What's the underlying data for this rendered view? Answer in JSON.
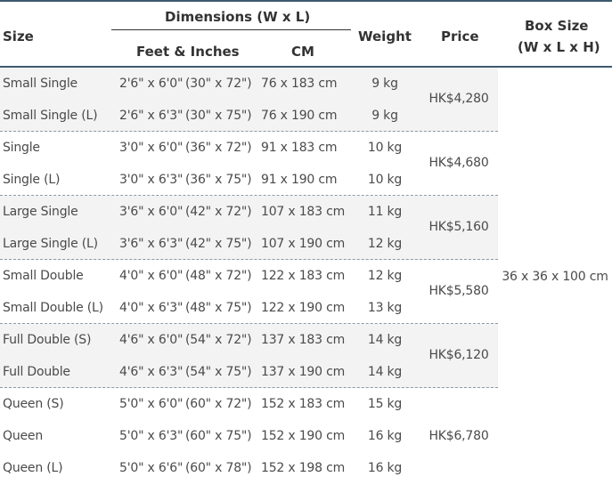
{
  "headers": {
    "size": "Size",
    "dimensions": "Dimensions (W x L)",
    "feet_inches": "Feet & Inches",
    "cm": "CM",
    "weight": "Weight",
    "price": "Price",
    "box_size_line1": "Box Size",
    "box_size_line2": "(W x L x H)"
  },
  "box_size": "36 x 36 x 100 cm",
  "groups": [
    {
      "price": "HK$4,280",
      "rows": [
        {
          "size": "Small Single",
          "feet": "2'6\" x 6'0\"",
          "inches": "(30\" x 72\")",
          "cm": "76 x 183 cm",
          "weight": "9 kg"
        },
        {
          "size": "Small Single (L)",
          "feet": "2'6\" x 6'3\"",
          "inches": "(30\" x 75\")",
          "cm": "76 x 190 cm",
          "weight": "9 kg"
        }
      ]
    },
    {
      "price": "HK$4,680",
      "rows": [
        {
          "size": "Single",
          "feet": "3'0\" x 6'0\"",
          "inches": "(36\" x 72\")",
          "cm": "91 x 183 cm",
          "weight": "10 kg"
        },
        {
          "size": "Single (L)",
          "feet": "3'0\" x 6'3\"",
          "inches": "(36\" x 75\")",
          "cm": "91 x 190 cm",
          "weight": "10 kg"
        }
      ]
    },
    {
      "price": "HK$5,160",
      "rows": [
        {
          "size": "Large Single",
          "feet": "3'6\" x 6'0\"",
          "inches": "(42\" x 72\")",
          "cm": "107 x 183 cm",
          "weight": "11 kg"
        },
        {
          "size": "Large Single (L)",
          "feet": "3'6\" x 6'3\"",
          "inches": "(42\" x 75\")",
          "cm": "107 x 190 cm",
          "weight": "12 kg"
        }
      ]
    },
    {
      "price": "HK$5,580",
      "rows": [
        {
          "size": "Small Double",
          "feet": "4'0\" x 6'0\"",
          "inches": "(48\" x 72\")",
          "cm": "122 x 183 cm",
          "weight": "12 kg"
        },
        {
          "size": "Small Double (L)",
          "feet": "4'0\" x 6'3\"",
          "inches": "(48\" x 75\")",
          "cm": "122 x 190 cm",
          "weight": "13 kg"
        }
      ]
    },
    {
      "price": "HK$6,120",
      "rows": [
        {
          "size": "Full Double (S)",
          "feet": "4'6\" x 6'0\"",
          "inches": "(54\" x 72\")",
          "cm": "137 x 183 cm",
          "weight": "14 kg"
        },
        {
          "size": "Full Double",
          "feet": "4'6\" x 6'3\"",
          "inches": "(54\" x 75\")",
          "cm": "137 x 190 cm",
          "weight": "14 kg"
        }
      ]
    },
    {
      "price": "HK$6,780",
      "rows": [
        {
          "size": "Queen (S)",
          "feet": "5'0\" x 6'0\"",
          "inches": "(60\" x 72\")",
          "cm": "152 x 183 cm",
          "weight": "15 kg"
        },
        {
          "size": "Queen",
          "feet": "5'0\" x 6'3\"",
          "inches": "(60\" x 75\")",
          "cm": "152 x 190 cm",
          "weight": "16 kg"
        },
        {
          "size": "Queen (L)",
          "feet": "5'0\" x 6'6\"",
          "inches": "(60\" x 78\")",
          "cm": "152 x 198 cm",
          "weight": "16 kg"
        }
      ]
    }
  ]
}
